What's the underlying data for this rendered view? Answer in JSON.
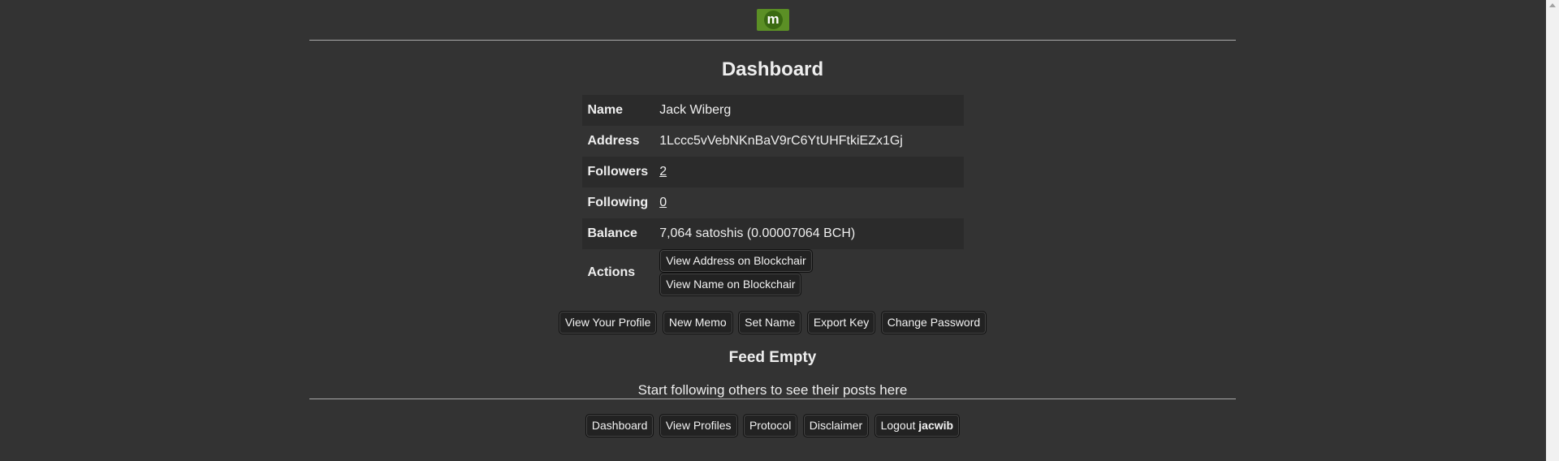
{
  "logo": {
    "letter": "m",
    "color": "#5b8f25"
  },
  "page_title": "Dashboard",
  "profile": {
    "rows": [
      {
        "label": "Name",
        "value": "Jack Wiberg"
      },
      {
        "label": "Address",
        "value": "1Lccc5vVebNKnBaV9rC6YtUHFtkiEZx1Gj"
      },
      {
        "label": "Followers",
        "value": "2"
      },
      {
        "label": "Following",
        "value": "0"
      },
      {
        "label": "Balance",
        "value": "7,064 satoshis (0.00007064 BCH)"
      },
      {
        "label": "Actions"
      }
    ],
    "actions": {
      "view_address": "View Address on Blockchair",
      "view_name": "View Name on Blockchair"
    }
  },
  "nav_buttons": {
    "view_profile": "View Your Profile",
    "new_memo": "New Memo",
    "set_name": "Set Name",
    "export_key": "Export Key",
    "change_password": "Change Password"
  },
  "feed": {
    "title": "Feed Empty",
    "message": "Start following others to see their posts here"
  },
  "footer": {
    "dashboard": "Dashboard",
    "view_profiles": "View Profiles",
    "protocol": "Protocol",
    "disclaimer": "Disclaimer",
    "logout_prefix": "Logout",
    "username": "jacwib"
  }
}
